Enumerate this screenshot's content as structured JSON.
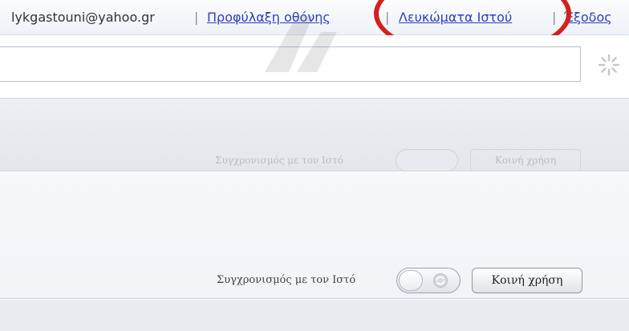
{
  "header": {
    "email": "lykgastouni@yahoo.gr",
    "separator": "|",
    "links": [
      {
        "label": "Προφύλαξη οθόνης"
      },
      {
        "label": "Λευκώματα Ιστού"
      },
      {
        "label": "Έξοδος"
      }
    ]
  },
  "search": {
    "value": "",
    "placeholder": ""
  },
  "ghost_row": {
    "sync_label": "Συγχρονισμός με τον Ιστό",
    "share_label": "Κοινή χρήση"
  },
  "sync_row": {
    "sync_label": "Συγχρονισμός με τον Ιστό",
    "share_label": "Κοινή χρήση",
    "toggle_on": false
  },
  "colors": {
    "link": "#2a3fbf",
    "annotation": "#d4201e"
  }
}
